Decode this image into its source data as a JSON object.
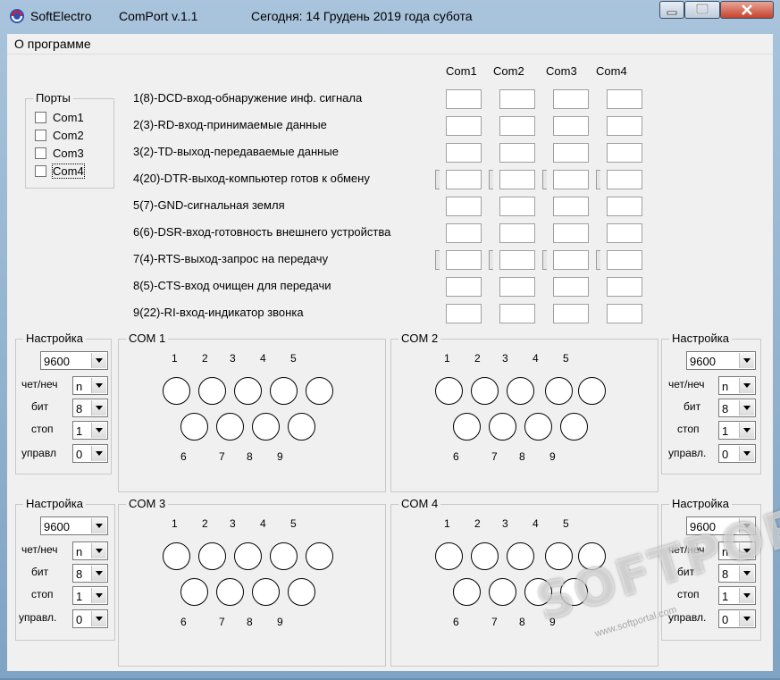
{
  "window": {
    "title_parts": [
      "SoftElectro",
      "ComPort v.1.1",
      "Сегодня: 14  Грудень  2019 года  субота"
    ]
  },
  "menu": {
    "items": [
      "О программе"
    ]
  },
  "ports": {
    "title": "Порты",
    "items": [
      "Com1",
      "Com2",
      "Com3",
      "Com4"
    ]
  },
  "columns": [
    "Com1",
    "Com2",
    "Com3",
    "Com4"
  ],
  "signals": [
    {
      "label": "1(8)-DCD-вход-обнаружение инф. сигнала",
      "toggle": false
    },
    {
      "label": "2(3)-RD-вход-принимаемые данные",
      "toggle": false
    },
    {
      "label": "3(2)-TD-выход-передаваемые данные",
      "toggle": false
    },
    {
      "label": "4(20)-DTR-выход-компьютер готов к обмену",
      "toggle": true
    },
    {
      "label": "5(7)-GND-сигнальная земля",
      "toggle": false
    },
    {
      "label": "6(6)-DSR-вход-готовность внешнего устройства",
      "toggle": false
    },
    {
      "label": "7(4)-RTS-выход-запрос на передачу",
      "toggle": true
    },
    {
      "label": "8(5)-CTS-вход очищен для передачи",
      "toggle": false
    },
    {
      "label": "9(22)-RI-вход-индикатор звонка",
      "toggle": false
    }
  ],
  "settings_panels": [
    {
      "title": "Настройка",
      "baud": "9600",
      "labels": [
        "чет/неч",
        "бит",
        "стоп",
        "управл"
      ],
      "values": [
        "n",
        "8",
        "1",
        "0"
      ]
    },
    {
      "title": "Настройка",
      "baud": "9600",
      "labels": [
        "чет/неч",
        "бит",
        "стоп",
        "управл."
      ],
      "values": [
        "n",
        "8",
        "1",
        "0"
      ]
    },
    {
      "title": "Настройка",
      "baud": "9600",
      "labels": [
        "чет/неч",
        "бит",
        "стоп",
        "управл."
      ],
      "values": [
        "n",
        "8",
        "1",
        "0"
      ]
    },
    {
      "title": "Настройка",
      "baud": "9600",
      "labels": [
        "чет/неч",
        "бит",
        "стоп",
        "управл."
      ],
      "values": [
        "n",
        "8",
        "1",
        "0"
      ]
    }
  ],
  "connectors": [
    {
      "title": "COM 1",
      "top_numbers": [
        "1",
        "2",
        "3",
        "4",
        "5"
      ],
      "bottom_numbers": [
        "6",
        "7",
        "8",
        "9"
      ]
    },
    {
      "title": "COM 2",
      "top_numbers": [
        "1",
        "2",
        "3",
        "4",
        "5"
      ],
      "bottom_numbers": [
        "6",
        "7",
        "8",
        "9"
      ]
    },
    {
      "title": "COM 3",
      "top_numbers": [
        "1",
        "2",
        "3",
        "4",
        "5"
      ],
      "bottom_numbers": [
        "6",
        "7",
        "8",
        "9"
      ]
    },
    {
      "title": "COM 4",
      "top_numbers": [
        "1",
        "2",
        "3",
        "4",
        "5"
      ],
      "bottom_numbers": [
        "6",
        "7",
        "8",
        "9"
      ]
    }
  ],
  "watermark": {
    "text": "SOFTPORTAL",
    "sub": "www.softportal.com"
  }
}
